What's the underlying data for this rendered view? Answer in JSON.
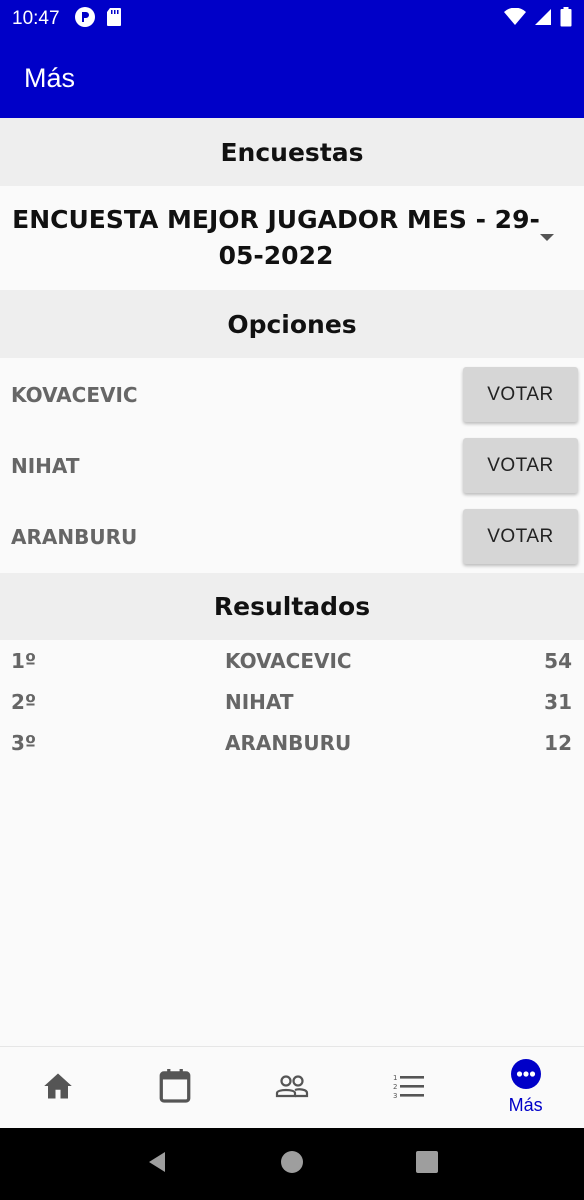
{
  "status_bar": {
    "time": "10:47"
  },
  "app_bar": {
    "title": "Más"
  },
  "surveys": {
    "header": "Encuestas",
    "selected": "ENCUESTA MEJOR JUGADOR MES - 29-05-2022"
  },
  "options": {
    "header": "Opciones",
    "vote_label": "VOTAR",
    "items": [
      {
        "name": "KOVACEVIC"
      },
      {
        "name": "NIHAT"
      },
      {
        "name": "ARANBURU"
      }
    ]
  },
  "results": {
    "header": "Resultados",
    "rows": [
      {
        "position": "1º",
        "name": "KOVACEVIC",
        "votes": "54"
      },
      {
        "position": "2º",
        "name": "NIHAT",
        "votes": "31"
      },
      {
        "position": "3º",
        "name": "ARANBURU",
        "votes": "12"
      }
    ]
  },
  "bottom_nav": {
    "items": [
      {
        "icon": "home-icon",
        "label": ""
      },
      {
        "icon": "calendar-icon",
        "label": ""
      },
      {
        "icon": "people-icon",
        "label": ""
      },
      {
        "icon": "list-icon",
        "label": ""
      },
      {
        "icon": "more-icon",
        "label": "Más",
        "active": true
      }
    ]
  },
  "colors": {
    "primary": "#0000c8",
    "section_bg": "#eeeeee",
    "button_bg": "#d6d6d6",
    "muted_text": "#666666"
  }
}
